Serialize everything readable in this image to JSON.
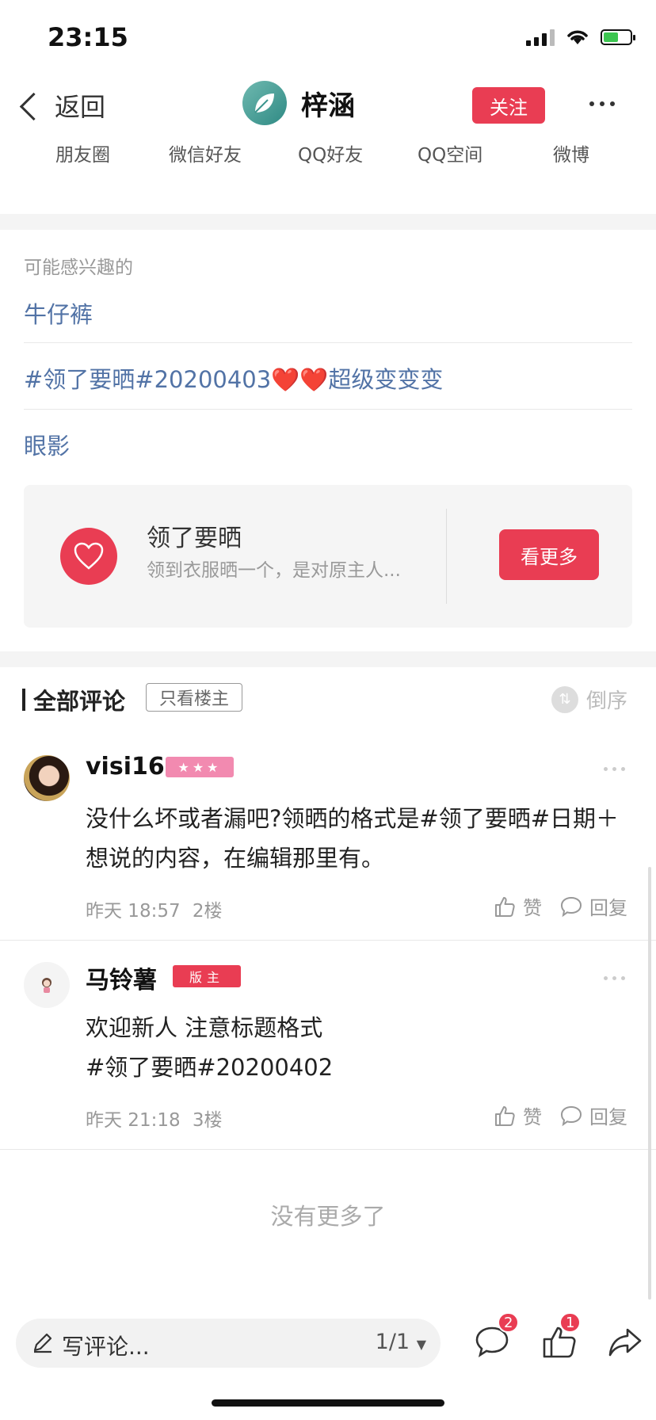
{
  "status": {
    "time": "23:15"
  },
  "nav": {
    "back_label": "返回",
    "user_name": "梓涵",
    "follow_label": "关注"
  },
  "share_targets": [
    "朋友圈",
    "微信好友",
    "QQ好友",
    "QQ空间",
    "微博"
  ],
  "interest": {
    "title": "可能感兴趣的",
    "items": [
      "牛仔裤",
      "#领了要晒#20200403❤️❤️超级变变变",
      "眼影"
    ]
  },
  "forum_card": {
    "title": "领了要晒",
    "description": "领到衣服晒一个，是对原主人...",
    "button_label": "看更多"
  },
  "comments_header": {
    "title": "全部评论",
    "only_host_label": "只看楼主",
    "order_label": "倒序"
  },
  "comments": [
    {
      "name": "visi16",
      "badge": "★★★",
      "text": "没什么坏或者漏吧?领晒的格式是#领了要晒#日期＋想说的内容，在编辑那里有。",
      "time": "昨天 18:57",
      "floor": "2楼",
      "like_label": "赞",
      "reply_label": "回复"
    },
    {
      "name": "马铃薯",
      "badge": "版主",
      "text_line1": "欢迎新人 注意标题格式",
      "text_line2": "#领了要晒#20200402",
      "time": "昨天 21:18",
      "floor": "3楼",
      "like_label": "赞",
      "reply_label": "回复"
    }
  ],
  "no_more": "没有更多了",
  "bottom_bar": {
    "input_placeholder": "写评论...",
    "page_indicator": "1/1",
    "comment_count": "2",
    "like_count": "1"
  },
  "colors": {
    "accent": "#e93d53",
    "link": "#5273a6"
  }
}
